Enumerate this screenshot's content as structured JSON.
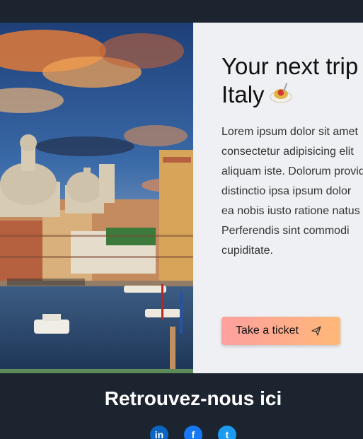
{
  "hero": {
    "image_alt_semantic": "venice-grand-canal-photo",
    "title_line1": "Your next trip",
    "title_line2": "Italy",
    "title_emoji": "spaghetti-emoji",
    "description_lines": [
      "Lorem ipsum dolor sit amet",
      "consectetur adipisicing elit",
      "aliquam iste. Dolorum provident",
      "distinctio ipsa ipsum dolor",
      "ea nobis iusto ratione natus",
      "Perferendis sint commodi",
      "cupiditate."
    ],
    "cta_label": "Take a ticket",
    "cta_icon": "paper-plane-icon"
  },
  "footer": {
    "title": "Retrouvez-nous ici",
    "socials": [
      {
        "name": "linkedin-icon",
        "glyph": "in",
        "color": "#0a66c2"
      },
      {
        "name": "facebook-icon",
        "glyph": "f",
        "color": "#1877f2"
      },
      {
        "name": "twitter-icon",
        "glyph": "t",
        "color": "#1d9bf0"
      }
    ]
  },
  "colors": {
    "background": "#1c2430",
    "panel": "#eff0f3",
    "cta_gradient_start": "#fea0a0",
    "cta_gradient_end": "#ffb877"
  }
}
